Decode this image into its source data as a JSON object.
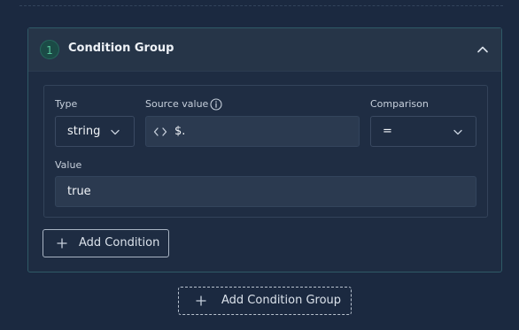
{
  "group": {
    "number": "1",
    "title": "Condition Group"
  },
  "condition": {
    "type_label": "Type",
    "type_value": "string",
    "source_label": "Source value",
    "source_value": "$.",
    "comparison_label": "Comparison",
    "comparison_value": "=",
    "value_label": "Value",
    "value_value": "true"
  },
  "buttons": {
    "add_condition": "Add Condition",
    "add_condition_group": "Add Condition Group"
  },
  "icons": {
    "collapse": "chevron-up-icon",
    "dropdown": "chevron-down-icon",
    "info": "info-icon",
    "code": "code-brackets-icon",
    "add": "plus-icon"
  },
  "colors": {
    "background": "#1b2940",
    "badge_text": "#56c59a",
    "group_border": "#2f5a66"
  }
}
